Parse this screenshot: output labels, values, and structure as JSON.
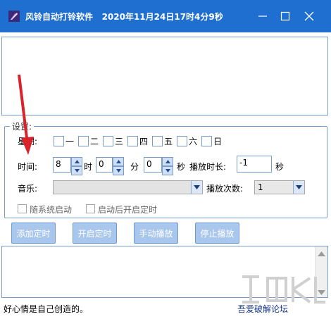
{
  "title": {
    "app_name": "风铃自动打铃软件",
    "datetime": "2020年11月24日17时4分9秒"
  },
  "settings": {
    "legend": "设置:",
    "week_label": "星期:",
    "weekdays": [
      "一",
      "二",
      "三",
      "四",
      "五",
      "六",
      "日"
    ],
    "time_label": "时间:",
    "hour_value": "8",
    "hour_unit": "时",
    "minute_value": "0",
    "minute_unit": "分",
    "second_value": "0",
    "second_unit": "秒",
    "duration_label": "播放时长:",
    "duration_value": "-1",
    "duration_unit": "秒",
    "music_label": "音乐:",
    "music_value": "",
    "play_count_label": "播放次数:",
    "play_count_value": "1",
    "autostart_label": "随系统启动",
    "start_timer_on_launch_label": "启动后开启定时"
  },
  "buttons": {
    "add_timer": "添加定时",
    "start_timer": "开启定时",
    "manual_play": "手动播放",
    "stop_play": "停止播放"
  },
  "status": {
    "motto": "好心情是自己创造的。",
    "forum_link": "吾爱破解论坛"
  },
  "colors": {
    "titlebar": "#1f6fd1",
    "button": "#a9c6ec",
    "border": "#7a9cc9",
    "link": "#1a3a8c"
  },
  "icons": [
    "app-feather-icon",
    "minimize-icon",
    "maximize-icon",
    "close-icon",
    "spin-up-icon",
    "spin-down-icon",
    "chevron-down-icon"
  ]
}
